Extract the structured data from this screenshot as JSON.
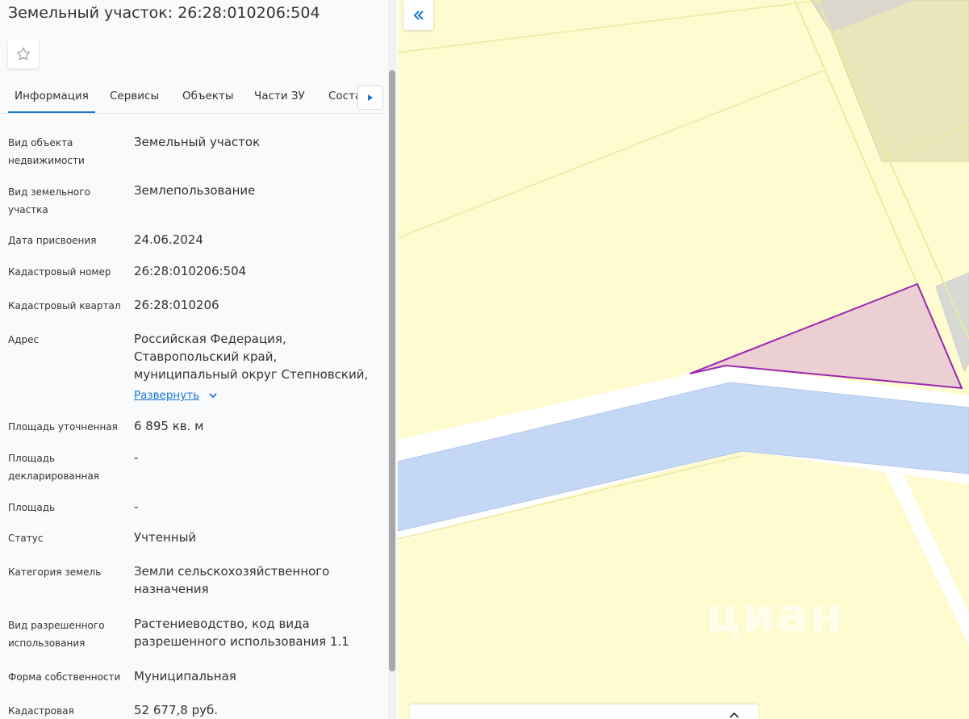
{
  "header": {
    "title": "Земельный участок: 26:28:010206:504"
  },
  "tabs": [
    {
      "label": "Информация",
      "active": true
    },
    {
      "label": "Сервисы"
    },
    {
      "label": "Объекты"
    },
    {
      "label": "Части ЗУ"
    },
    {
      "label": "Состав"
    }
  ],
  "info": {
    "object_type": {
      "label": "Вид объекта недвижимости",
      "value": "Земельный участок"
    },
    "land_type": {
      "label": "Вид земельного участка",
      "value": "Землепользование"
    },
    "assign_date": {
      "label": "Дата присвоения",
      "value": "24.06.2024"
    },
    "cadastral_number": {
      "label": "Кадастровый номер",
      "value": "26:28:010206:504"
    },
    "cadastral_block": {
      "label": "Кадастровый квартал",
      "value": "26:28:010206"
    },
    "address": {
      "label": "Адрес",
      "value": "Российская Федерация, Ставропольский край, муниципальный округ Степновский,"
    },
    "expand_label": "Развернуть",
    "area_refined": {
      "label": "Площадь уточненная",
      "value": "6 895 кв. м"
    },
    "area_declared": {
      "label": "Площадь декларированная",
      "value": "-"
    },
    "area": {
      "label": "Площадь",
      "value": "-"
    },
    "status": {
      "label": "Статус",
      "value": "Учтенный"
    },
    "land_category": {
      "label": "Категория земель",
      "value": "Земли сельскохозяйственного назначения"
    },
    "permitted_use": {
      "label": "Вид разрешенного использования",
      "value": "Растениеводство, код вида разрешенного использования 1.1"
    },
    "ownership": {
      "label": "Форма собственности",
      "value": "Муниципальная"
    },
    "cadastral_value": {
      "label": "Кадастровая",
      "value": "52 677,8 руб."
    }
  },
  "map": {
    "watermark": "циан",
    "colors": {
      "plot": "#fffbd0",
      "plot_border": "#ece9a0",
      "road": "#ffffff",
      "water": "#c4d8f5",
      "selected_fill": "#ebcfd3",
      "selected_border": "#9c27b0",
      "gray": "#d4d4d0"
    }
  },
  "icons": {
    "favorite": "star-outline-icon",
    "collapse": "double-chevron-left-icon",
    "tab_next": "triangle-right-icon",
    "expand": "chevron-down-icon"
  }
}
